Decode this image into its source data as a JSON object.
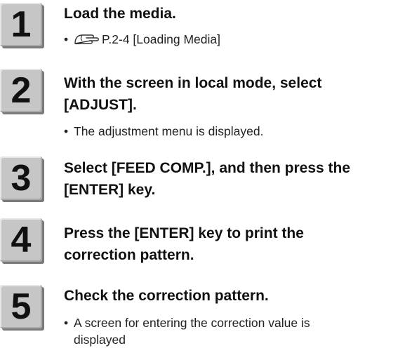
{
  "steps": [
    {
      "number": "1",
      "title": "Load the media.",
      "bullet_prefix": "•",
      "bullet": "P.2-4 [Loading Media]",
      "icon": "reference-hand-icon"
    },
    {
      "number": "2",
      "title_line1": "With the screen in local mode, select",
      "title_line2": "[ADJUST].",
      "bullet_prefix": "•",
      "bullet": "The adjustment menu is displayed."
    },
    {
      "number": "3",
      "title_line1": "Select [FEED COMP.], and then press the",
      "title_line2": "[ENTER] key."
    },
    {
      "number": "4",
      "title_line1": "Press the [ENTER] key to print the",
      "title_line2": "correction pattern."
    },
    {
      "number": "5",
      "title": "Check the correction pattern.",
      "bullet_prefix": "•",
      "bullet_line1": "A screen for entering the correction value is",
      "bullet_line2": "displayed"
    }
  ]
}
